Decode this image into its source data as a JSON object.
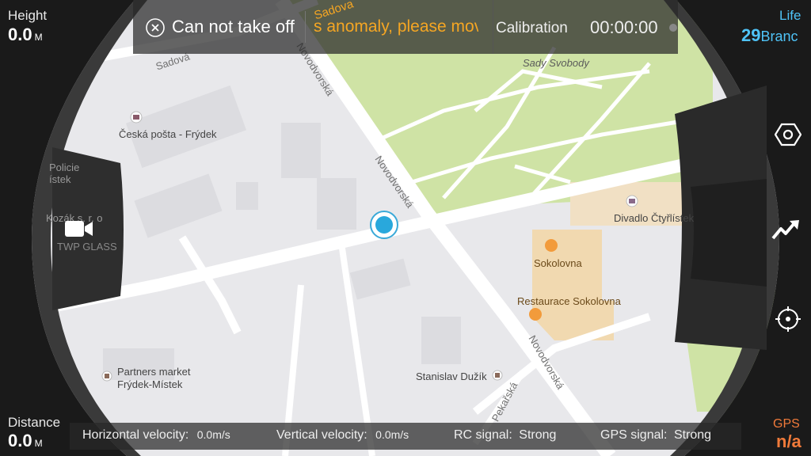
{
  "status": {
    "warning": "Can not take off",
    "scroll_text": "s anomaly, please mov",
    "scroll_prefix": "Sadova",
    "calibration_label": "Calibration",
    "timer": "00:00:00"
  },
  "telemetry": {
    "height_label": "Height",
    "height_value": "0.0",
    "height_unit": "M",
    "distance_label": "Distance",
    "distance_value": "0.0",
    "distance_unit": "M",
    "life_label": "Life",
    "life_value": "29",
    "life_suffix": "Branc",
    "gps_label": "GPS",
    "gps_value": "n/a"
  },
  "bottom": {
    "h_vel_label": "Horizontal velocity:",
    "h_vel_value": "0.0m/s",
    "v_vel_label": "Vertical velocity:",
    "v_vel_value": "0.0m/s",
    "rc_label": "RC signal:",
    "rc_value": "Strong",
    "gps_label": "GPS signal:",
    "gps_value": "Strong"
  },
  "map": {
    "labels": {
      "sadova": "Sadová",
      "sady_svobody": "Sady Svobody",
      "ceska_posta": "Česká pošta - Frýdek",
      "novodvorska1": "Novodvorská",
      "novodvorska2": "Novodvorská",
      "novodvorska3": "Novodvorská",
      "divadlo": "Divadlo Čtyřlístek",
      "sokolovna": "Sokolovna",
      "restaurace": "Restaurace Sokolovna",
      "policie1": "Policie",
      "policie2": "ístek",
      "kozak": "Kozák s. r. o",
      "twp": "TWP GLASS",
      "partners1": "Partners market",
      "partners2": "Frýdek-Místek",
      "duzik": "Stanislav Dužík",
      "pekarska": "Pekařská"
    }
  },
  "colors": {
    "accent_blue": "#4fc3f7",
    "warning_orange": "#f5a623",
    "gps_orange": "#f07a3a",
    "park_green": "#cfe3a5",
    "map_bg": "#e9e9ec"
  }
}
